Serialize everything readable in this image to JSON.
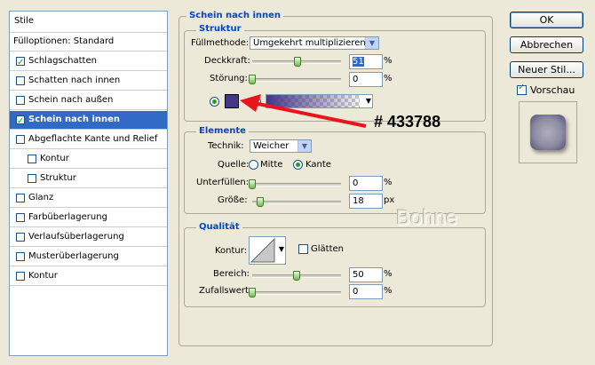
{
  "styles_panel": {
    "header": "Stile",
    "items": [
      {
        "label": "Fülloptionen: Standard",
        "checkbox": false,
        "checked": false,
        "indent": false,
        "selected": false
      },
      {
        "label": "Schlagschatten",
        "checkbox": true,
        "checked": true,
        "indent": false,
        "selected": false
      },
      {
        "label": "Schatten nach innen",
        "checkbox": true,
        "checked": false,
        "indent": false,
        "selected": false
      },
      {
        "label": "Schein nach außen",
        "checkbox": true,
        "checked": false,
        "indent": false,
        "selected": false
      },
      {
        "label": "Schein nach innen",
        "checkbox": true,
        "checked": true,
        "indent": false,
        "selected": true
      },
      {
        "label": "Abgeflachte Kante und Relief",
        "checkbox": true,
        "checked": false,
        "indent": false,
        "selected": false
      },
      {
        "label": "Kontur",
        "checkbox": true,
        "checked": false,
        "indent": true,
        "selected": false
      },
      {
        "label": "Struktur",
        "checkbox": true,
        "checked": false,
        "indent": true,
        "selected": false
      },
      {
        "label": "Glanz",
        "checkbox": true,
        "checked": false,
        "indent": false,
        "selected": false
      },
      {
        "label": "Farbüberlagerung",
        "checkbox": true,
        "checked": false,
        "indent": false,
        "selected": false
      },
      {
        "label": "Verlaufsüberlagerung",
        "checkbox": true,
        "checked": false,
        "indent": false,
        "selected": false
      },
      {
        "label": "Musterüberlagerung",
        "checkbox": true,
        "checked": false,
        "indent": false,
        "selected": false
      },
      {
        "label": "Kontur",
        "checkbox": true,
        "checked": false,
        "indent": false,
        "selected": false
      }
    ]
  },
  "main": {
    "title": "Schein nach innen",
    "struktur": {
      "title": "Struktur",
      "fuellmethode_label": "Füllmethode:",
      "fuellmethode_value": "Umgekehrt multiplizieren",
      "deckkraft_label": "Deckkraft:",
      "deckkraft_value": "51",
      "deckkraft_level": 0.51,
      "stoerung_label": "Störung:",
      "stoerung_value": "0",
      "stoerung_level": 0,
      "percent": "%",
      "color_swatch": "#433788",
      "color_mode": "solid"
    },
    "elemente": {
      "title": "Elemente",
      "technik_label": "Technik:",
      "technik_value": "Weicher",
      "quelle_label": "Quelle:",
      "quelle_options": [
        "Mitte",
        "Kante"
      ],
      "quelle_selected": "Kante",
      "unterfuellen_label": "Unterfüllen:",
      "unterfuellen_value": "0",
      "unterfuellen_level": 0,
      "groesse_label": "Größe:",
      "groesse_value": "18",
      "groesse_unit": "px",
      "percent": "%"
    },
    "qualitaet": {
      "title": "Qualität",
      "kontur_label": "Kontur:",
      "glaetten_label": "Glätten",
      "glaetten_checked": false,
      "bereich_label": "Bereich:",
      "bereich_value": "50",
      "bereich_level": 0.5,
      "zufallswert_label": "Zufallswert:",
      "zufallswert_value": "0",
      "zufallswert_level": 0,
      "percent": "%"
    }
  },
  "annotation": {
    "text": "# 433788",
    "arrow_color": "#e8161c"
  },
  "watermark": "Bohne",
  "buttons": {
    "ok": "OK",
    "cancel": "Abbrechen",
    "new_style": "Neuer Stil...",
    "preview_label": "Vorschau",
    "preview_checked": true
  },
  "colors": {
    "accent": "#316ac5",
    "group_title": "#0046d5",
    "swatch": "#433788"
  }
}
